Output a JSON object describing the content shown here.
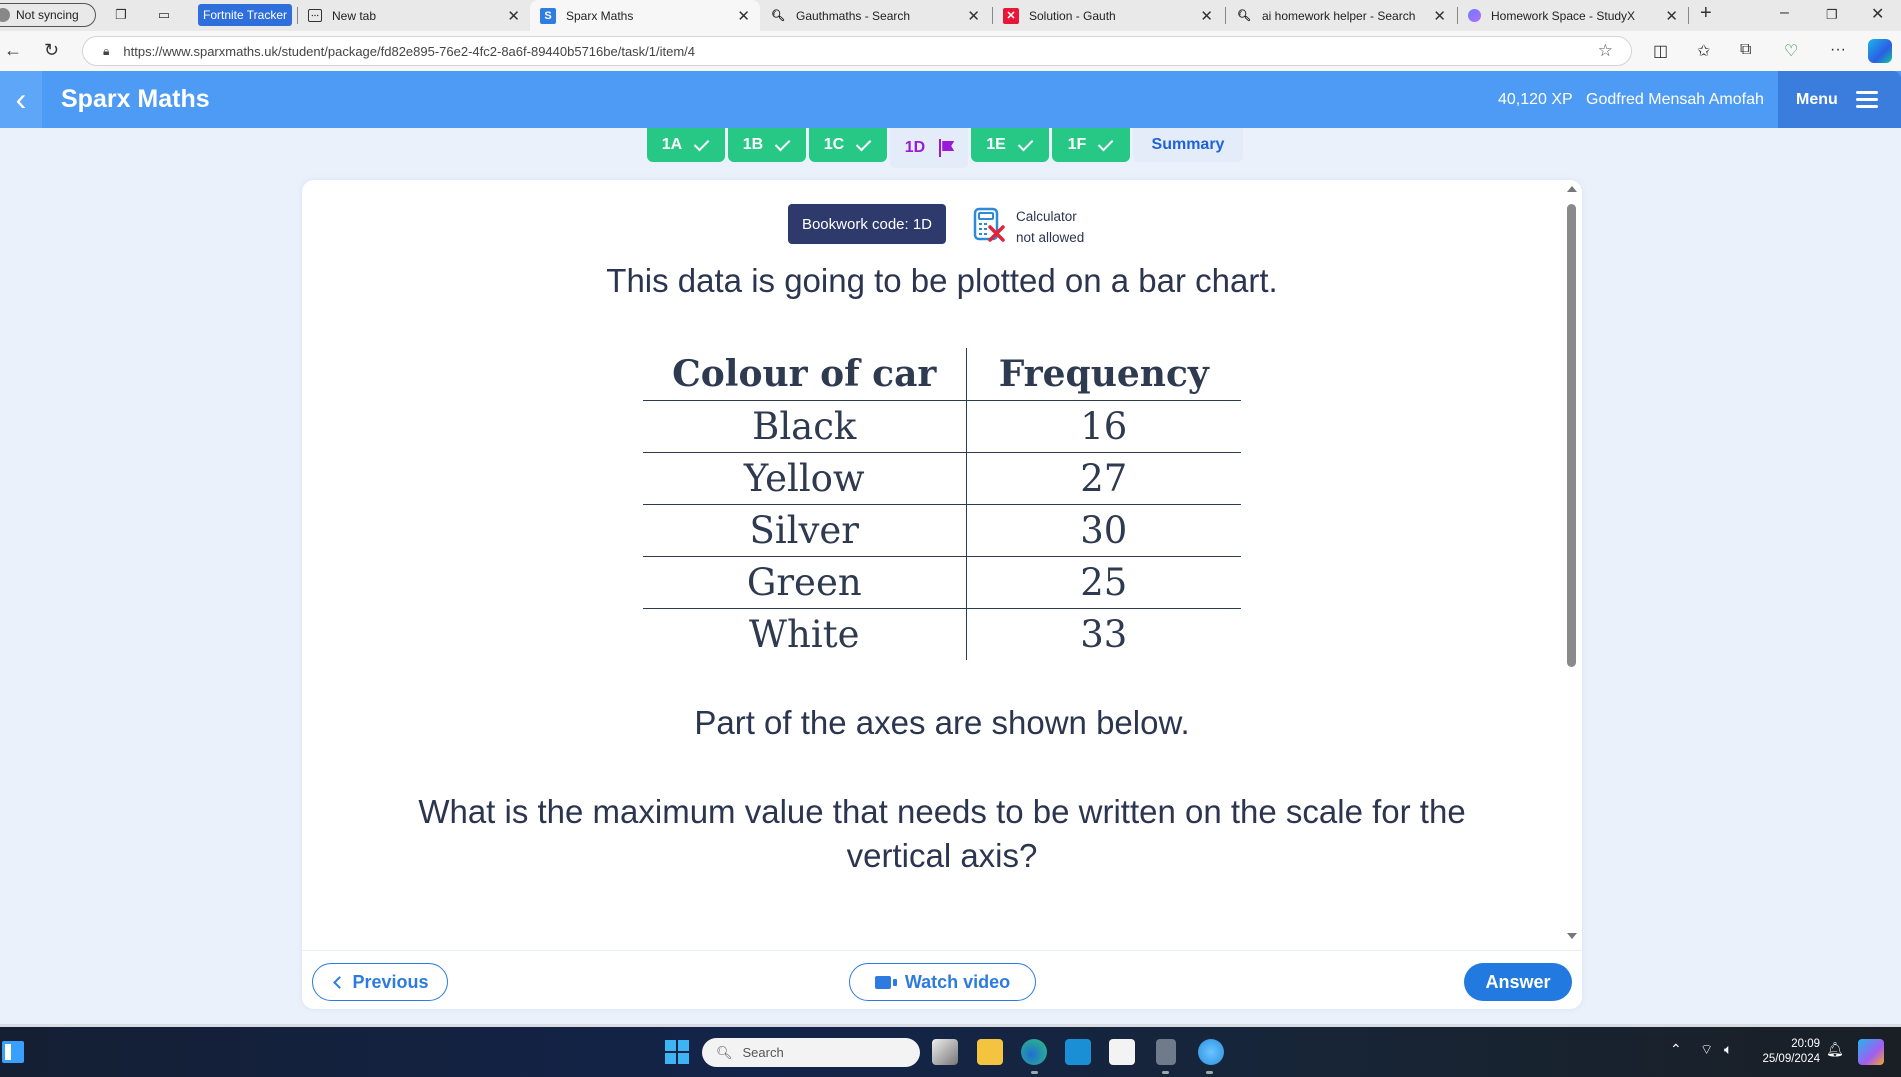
{
  "browser": {
    "profile_label": "Not syncing",
    "pinned_tab": "Fortnite Tracker",
    "tabs": [
      {
        "title": "New tab",
        "icon": "new-tab-icon"
      },
      {
        "title": "Sparx Maths",
        "icon": "sparx-s-icon",
        "active": true
      },
      {
        "title": "Gauthmaths - Search",
        "icon": "search-icon"
      },
      {
        "title": "Solution - Gauth",
        "icon": "gauth-icon"
      },
      {
        "title": "ai homework helper - Search",
        "icon": "search-icon"
      },
      {
        "title": "Homework Space - StudyX",
        "icon": "studyx-icon"
      }
    ],
    "url": "https://www.sparxmaths.uk/student/package/fd82e895-76e2-4fc2-8a6f-89440b5716be/task/1/item/4"
  },
  "app": {
    "name": "Sparx Maths",
    "xp": "40,120 XP",
    "user_name": "Godfred Mensah Amofah",
    "menu_label": "Menu",
    "accent_color": "#4e9bf6"
  },
  "steps": [
    {
      "label": "1A",
      "status": "complete"
    },
    {
      "label": "1B",
      "status": "complete"
    },
    {
      "label": "1C",
      "status": "complete"
    },
    {
      "label": "1D",
      "status": "current"
    },
    {
      "label": "1E",
      "status": "complete"
    },
    {
      "label": "1F",
      "status": "complete"
    },
    {
      "label": "Summary",
      "status": "summary"
    }
  ],
  "question": {
    "bookwork_code": "Bookwork code: 1D",
    "calculator_line1": "Calculator",
    "calculator_line2": "not allowed",
    "intro": "This data is going to be plotted on a bar chart.",
    "table": {
      "headers": [
        "Colour of car",
        "Frequency"
      ],
      "rows": [
        [
          "Black",
          "16"
        ],
        [
          "Yellow",
          "27"
        ],
        [
          "Silver",
          "30"
        ],
        [
          "Green",
          "25"
        ],
        [
          "White",
          "33"
        ]
      ]
    },
    "axes_note": "Part of the axes are shown below.",
    "prompt": "What is the maximum value that needs to be written on the scale for the vertical axis?"
  },
  "footer": {
    "previous_label": "Previous",
    "video_label": "Watch video",
    "answer_label": "Answer"
  },
  "taskbar": {
    "search_placeholder": "Search",
    "time": "20:09",
    "date": "25/09/2024"
  }
}
